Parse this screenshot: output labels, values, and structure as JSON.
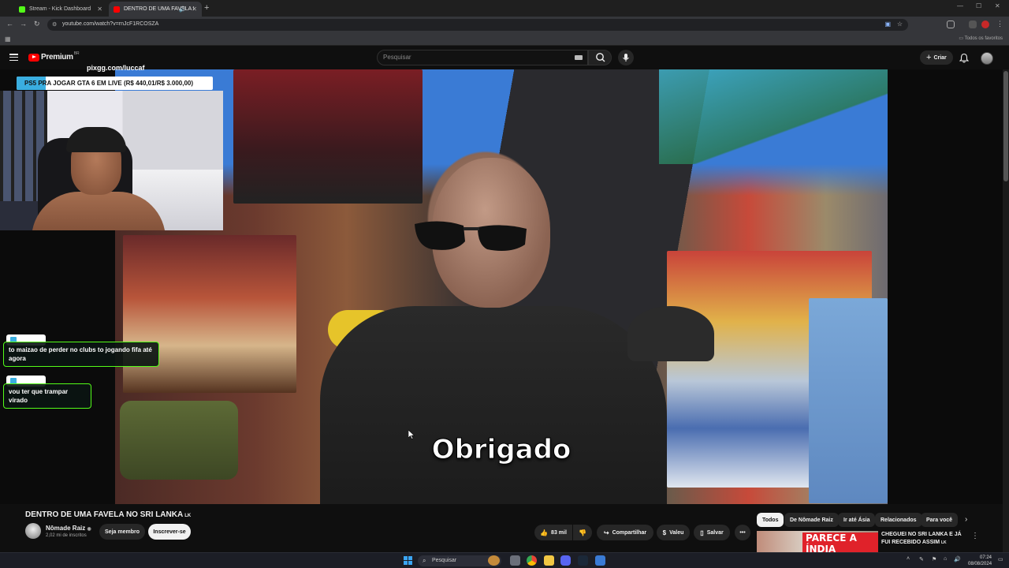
{
  "browser": {
    "tabs": [
      {
        "title": "Stream - Kick Dashboard",
        "favicon_color": "#53fc18",
        "active": false
      },
      {
        "title": "DENTRO DE UMA FAVELA I",
        "favicon_color": "#ff0000",
        "active": true
      }
    ],
    "url": "youtube.com/watch?v=rnJcF1RCOSZA",
    "bookmarks_folder": "Todos os favoritos"
  },
  "youtube_header": {
    "logo_text": "Premium",
    "region": "BR",
    "search_placeholder": "Pesquisar",
    "create_label": "Criar"
  },
  "stream_overlay": {
    "pix_link": "pixgg.com/luccaf",
    "goal_text": "PS5 PRA JOGAR GTA 6 EM LIVE (R$ 440,01/R$ 3.000,00)",
    "goal_progress": 0.1467,
    "chat_messages": [
      {
        "text": "to maizao de perder no clubs to jogando fifa até agora"
      },
      {
        "text": "vou ter que trampar virado"
      }
    ]
  },
  "video": {
    "caption": "Obrigado",
    "title": "DENTRO DE UMA FAVELA NO SRI LANKA",
    "title_flag": "LK",
    "channel": {
      "name": "Nômade Raiz",
      "subscribers": "2,02 mi de inscritos"
    },
    "member_button": "Seja membro",
    "subscribe_button": "Inscrever-se",
    "likes": "83 mil",
    "share_label": "Compartilhar",
    "thanks_label": "Valeu",
    "save_label": "Salvar"
  },
  "filters": [
    "Todos",
    "De Nômade Raiz",
    "Ir até Ásia",
    "Relacionados",
    "Para você"
  ],
  "recommended": {
    "thumb_text": "PARECE A ÍNDIA",
    "title": "CHEGUEI NO SRI LANKA E JÁ FUI RECEBIDO ASSIM",
    "title_flag": "LK"
  },
  "taskbar": {
    "search_placeholder": "Pesquisar",
    "time": "07:24",
    "date": "08/08/2024"
  }
}
